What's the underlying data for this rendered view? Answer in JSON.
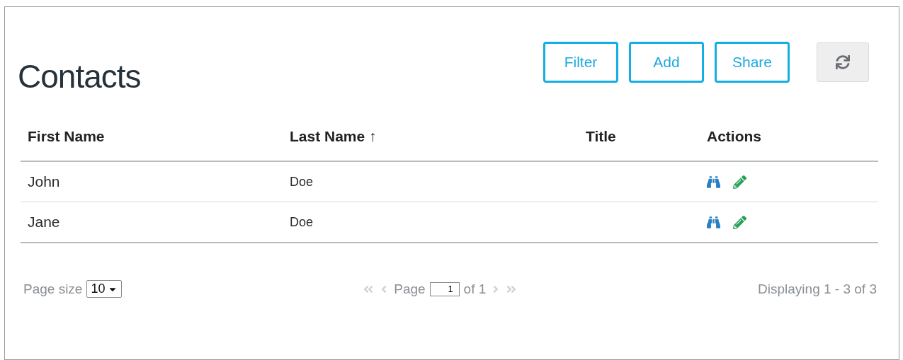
{
  "title": "Contacts",
  "toolbar": {
    "buttons": [
      {
        "label": "Filter"
      },
      {
        "label": "Add"
      },
      {
        "label": "Share"
      }
    ],
    "refresh": {
      "disabled": false
    }
  },
  "table": {
    "columns": [
      {
        "label": "First Name"
      },
      {
        "label": "Last Name",
        "sort_indicator": "↑"
      },
      {
        "label": "Title"
      },
      {
        "label": "Actions"
      }
    ],
    "rows": [
      {
        "first_name": "John",
        "last_name": "Doe"
      },
      {
        "first_name": "Jane",
        "last_name": "Doe"
      }
    ]
  },
  "footer": {
    "page_size_label": "Page size",
    "page_size": "10",
    "page_label": "Page",
    "page": "1",
    "of_pages": "of 1",
    "prev_disabled": true,
    "next_disabled": true,
    "displaying": "Displaying 1 - 3 of 3"
  }
}
